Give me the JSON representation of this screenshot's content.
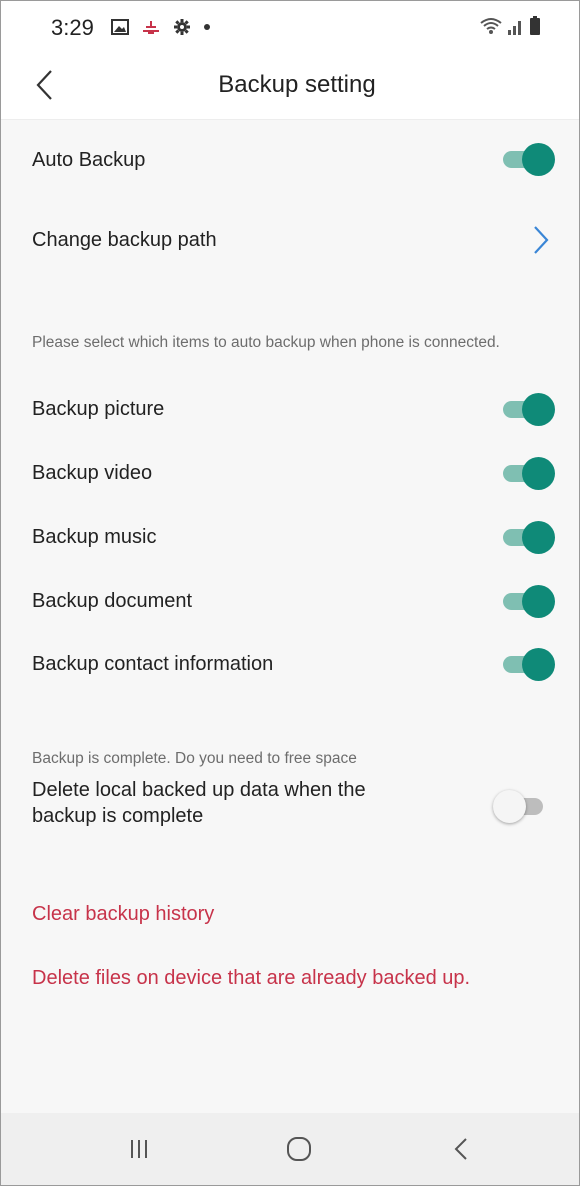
{
  "status_bar": {
    "time": "3:29",
    "left_icons": [
      "gallery-icon",
      "notification-icon",
      "settings-gear-icon",
      "dot-icon"
    ],
    "right_icons": [
      "wifi-icon",
      "signal-icon",
      "battery-icon"
    ]
  },
  "header": {
    "title": "Backup setting",
    "back_icon": "chevron-left-icon"
  },
  "general": {
    "auto_backup_label": "Auto Backup",
    "auto_backup_on": true,
    "change_path_label": "Change backup path"
  },
  "items": {
    "hint": "Please select which items to auto backup when phone is connected.",
    "list": [
      {
        "label": "Backup picture",
        "on": true
      },
      {
        "label": "Backup video",
        "on": true
      },
      {
        "label": "Backup music",
        "on": true
      },
      {
        "label": "Backup document",
        "on": true
      },
      {
        "label": "Backup contact information",
        "on": true
      }
    ]
  },
  "free_space": {
    "hint": "Backup is complete. Do you need to free space",
    "label": "Delete local backed up data when the backup is complete",
    "on": false
  },
  "actions": {
    "clear_history": "Clear backup history",
    "delete_files": "Delete files on device that are already backed up."
  },
  "colors": {
    "accent": "#0f8a78",
    "accent_track": "#7fbfb2",
    "danger": "#c7334a",
    "chevron": "#3a86d6"
  },
  "nav_bar": {
    "icons": [
      "recent-apps-icon",
      "home-icon",
      "back-icon"
    ]
  }
}
